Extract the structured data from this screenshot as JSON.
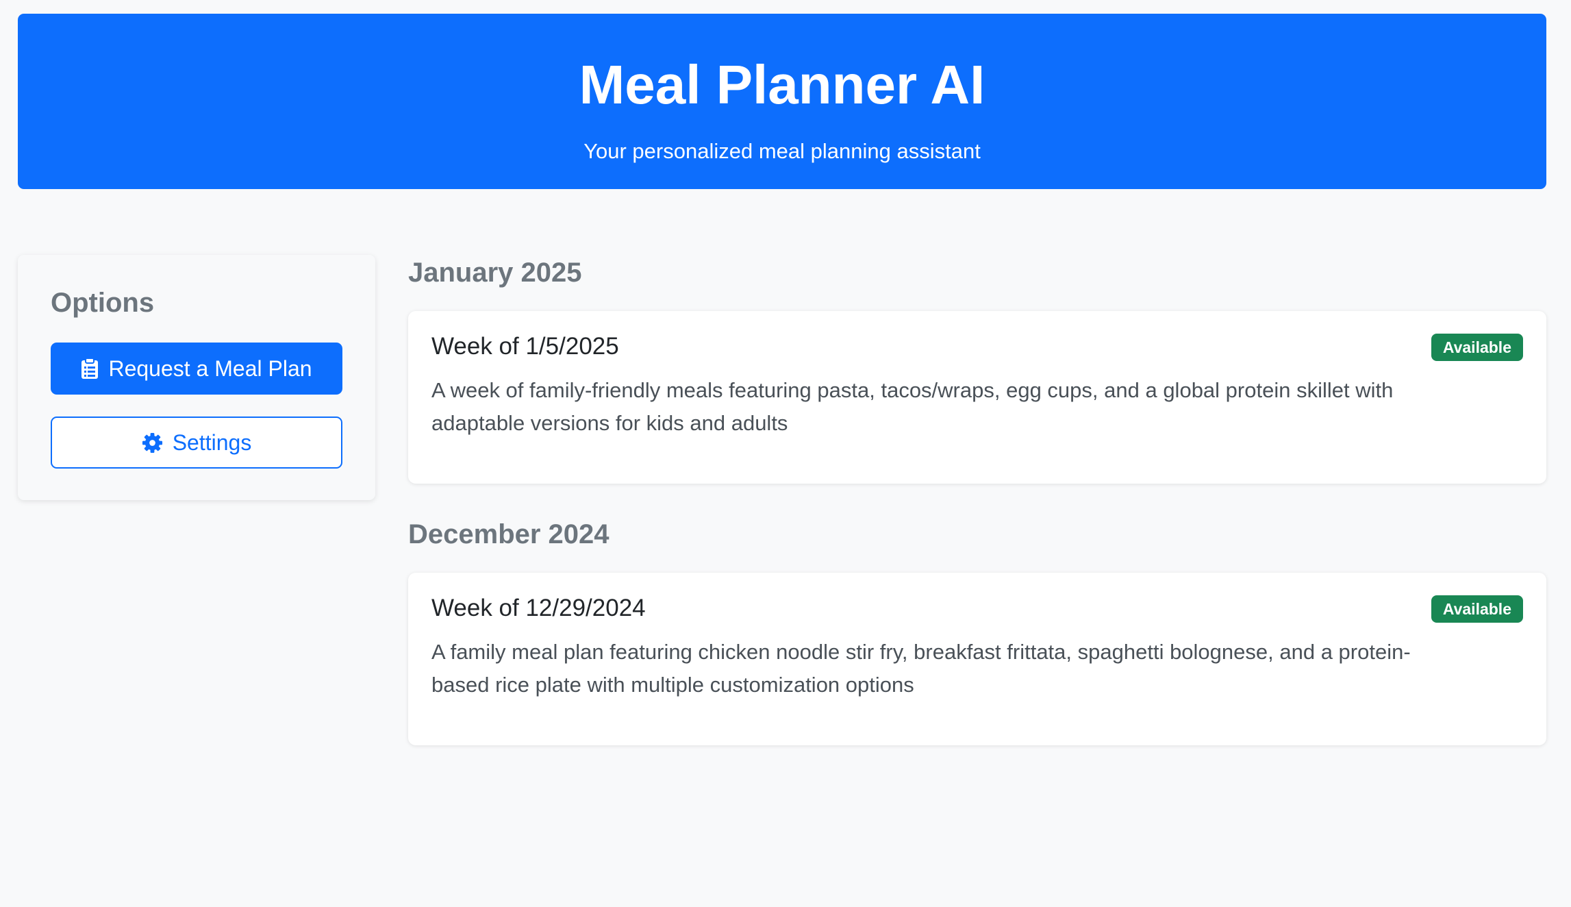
{
  "header": {
    "title": "Meal Planner AI",
    "subtitle": "Your personalized meal planning assistant"
  },
  "sidebar": {
    "heading": "Options",
    "request_button": {
      "label": "Request a Meal Plan",
      "icon": "clipboard-icon"
    },
    "settings_button": {
      "label": "Settings",
      "icon": "gear-icon"
    }
  },
  "months": [
    {
      "label": "January 2025",
      "plans": [
        {
          "title": "Week of 1/5/2025",
          "status": "Available",
          "description": "A week of family-friendly meals featuring pasta, tacos/wraps, egg cups, and a global protein skillet with adaptable versions for kids and adults"
        }
      ]
    },
    {
      "label": "December 2024",
      "plans": [
        {
          "title": "Week of 12/29/2024",
          "status": "Available",
          "description": "A family meal plan featuring chicken noodle stir fry, breakfast frittata, spaghetti bolognese, and a protein-based rice plate with multiple customization options"
        }
      ]
    }
  ],
  "colors": {
    "primary": "#0d6efd",
    "success": "#198754",
    "muted": "#6c757d",
    "background": "#f8f9fa"
  }
}
